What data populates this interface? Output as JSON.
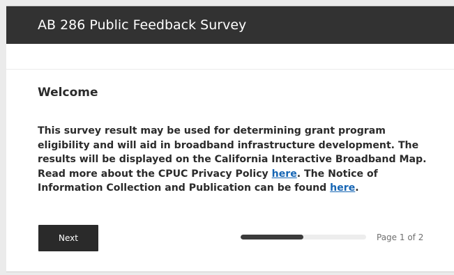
{
  "header": {
    "title": "AB 286 Public Feedback Survey"
  },
  "section": {
    "heading": "Welcome",
    "intro": {
      "text_before_link1": "This survey result may be used for determining grant program eligibility and will aid in broadband infrastructure development. The results will be displayed on the California Interactive Broadband Map. Read more about the CPUC Privacy Policy ",
      "link1_label": "here",
      "text_between_links": ". The Notice of Information Collection and Publication can be found ",
      "link2_label": "here",
      "text_after_link2": "."
    }
  },
  "footer": {
    "next_label": "Next",
    "progress_fraction": 0.5,
    "page_indicator": "Page 1 of 2"
  },
  "colors": {
    "header_bg": "#323232",
    "link": "#1565b4",
    "button_bg": "#2a2a2a",
    "progress_fill": "#3b3b3b",
    "progress_track": "#ededed"
  }
}
